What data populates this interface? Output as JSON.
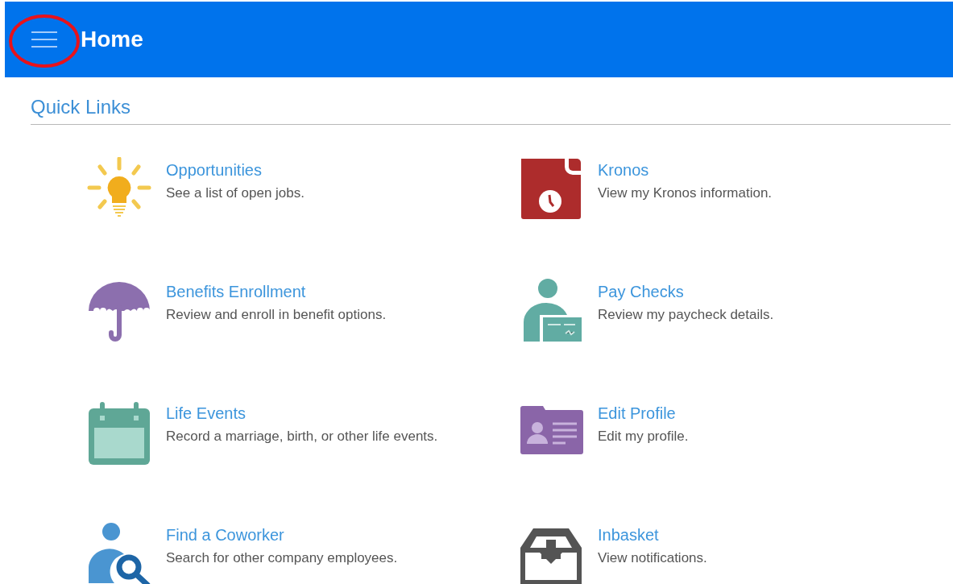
{
  "header": {
    "title": "Home"
  },
  "quick_links": {
    "title": "Quick Links",
    "items": [
      {
        "kind": "bulb",
        "title": "Opportunities",
        "description": "See a list of open jobs."
      },
      {
        "kind": "clock",
        "title": "Kronos",
        "description": "View my Kronos information."
      },
      {
        "kind": "umbrella",
        "title": "Benefits Enrollment",
        "description": "Review and enroll in benefit options."
      },
      {
        "kind": "paycheck",
        "title": "Pay Checks",
        "description": "Review my paycheck details."
      },
      {
        "kind": "calendar",
        "title": "Life Events",
        "description": "Record a marriage, birth, or other life events."
      },
      {
        "kind": "profile",
        "title": "Edit Profile",
        "description": "Edit my profile."
      },
      {
        "kind": "coworker",
        "title": "Find a Coworker",
        "description": "Search for other company employees."
      },
      {
        "kind": "inbox",
        "title": "Inbasket",
        "description": "View notifications."
      }
    ]
  }
}
